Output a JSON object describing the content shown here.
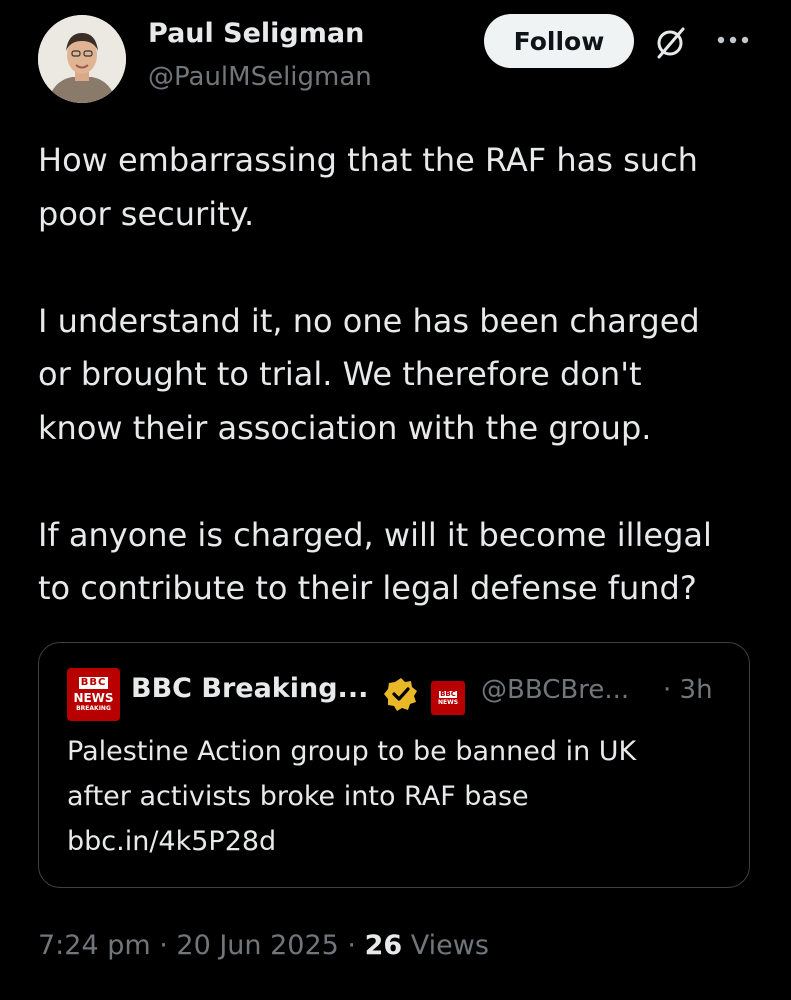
{
  "author": {
    "name": "Paul Seligman",
    "handle": "@PaulMSeligman"
  },
  "actions": {
    "follow_label": "Follow",
    "grok_icon": "grok-icon",
    "more_icon": "more-icon"
  },
  "tweet": {
    "text": "How embarrassing that the RAF has such\npoor security.\n\nI understand it, no one has been charged\nor brought to trial. We therefore don't\nknow their association with the group.\n\nIf anyone is charged, will it become illegal\nto contribute to their legal defense fund?"
  },
  "quote": {
    "logo": {
      "l1": "BBC",
      "l2": "NEWS",
      "l3": "BREAKING"
    },
    "name": "BBC Breaking...",
    "affiliate": {
      "a1": "BBC",
      "a2": "NEWS"
    },
    "handle": "@BBCBre...",
    "time": "· 3h",
    "text": "Palestine Action group to be banned in UK\nafter activists broke into RAF base\nbbc.in/4k5P28d",
    "colors": {
      "brand": "#b80000",
      "verified": "#e8b829"
    }
  },
  "meta": {
    "time": "7:24 pm",
    "sep1": " · ",
    "date": "20 Jun 2025",
    "sep2": " · ",
    "views_count": "26",
    "views_label": "Views"
  }
}
